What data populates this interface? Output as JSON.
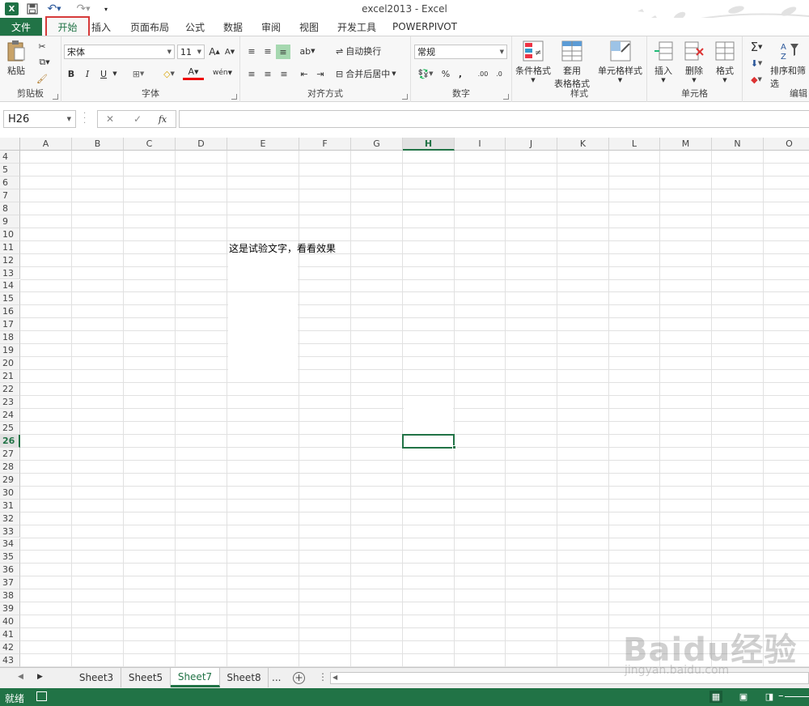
{
  "window": {
    "title": "excel2013 - Excel",
    "logo_letter": "X"
  },
  "ribbon_tabs": {
    "file": "文件",
    "home": "开始",
    "insert": "插入",
    "page_layout": "页面布局",
    "formulas": "公式",
    "data": "数据",
    "review": "审阅",
    "view": "视图",
    "developer": "开发工具",
    "powerpivot": "POWERPIVOT"
  },
  "ribbon": {
    "clipboard": {
      "label": "剪贴板",
      "paste": "粘贴"
    },
    "font": {
      "label": "字体",
      "font_name": "宋体",
      "font_size": "11",
      "bold": "B",
      "italic": "I",
      "underline": "U",
      "wen": "wén"
    },
    "alignment": {
      "label": "对齐方式",
      "wrap_text": "自动换行",
      "merge_center": "合并后居中"
    },
    "number": {
      "label": "数字",
      "format": "常规",
      "percent": "%",
      "comma": ",",
      "inc_dec": ".00",
      "dec_dec": ".0"
    },
    "styles": {
      "label": "样式",
      "conditional": "条件格式",
      "table_format_line1": "套用",
      "table_format_line2": "表格格式",
      "cell_styles": "单元格样式"
    },
    "cells": {
      "label": "单元格",
      "insert": "插入",
      "delete": "删除",
      "format": "格式"
    },
    "editing": {
      "label": "编辑",
      "sort_filter": "排序和筛选",
      "sigma": "Σ"
    }
  },
  "formula_bar": {
    "name_box": "H26",
    "cancel": "✕",
    "enter": "✓",
    "fx": "fx",
    "value": ""
  },
  "sheet": {
    "columns": [
      "A",
      "B",
      "C",
      "D",
      "E",
      "F",
      "G",
      "H",
      "I",
      "J",
      "K",
      "L",
      "M",
      "N",
      "O"
    ],
    "selected_column": "H",
    "rows": [
      "4",
      "5",
      "6",
      "7",
      "8",
      "9",
      "10",
      "11",
      "12",
      "13",
      "14",
      "15",
      "16",
      "17",
      "18",
      "19",
      "20",
      "21",
      "22",
      "23",
      "24",
      "25",
      "26",
      "27",
      "28",
      "29",
      "30",
      "31",
      "32",
      "33",
      "34",
      "35",
      "36",
      "37",
      "38",
      "39",
      "40",
      "41",
      "42",
      "43"
    ],
    "selected_row": "26",
    "active_cell": "H26",
    "cell_text": "这是试验文字，看看效果"
  },
  "sheet_tabs": {
    "tabs": [
      "Sheet3",
      "Sheet5",
      "Sheet7",
      "Sheet8"
    ],
    "active": "Sheet7",
    "more": "...",
    "add": "+"
  },
  "status": {
    "text": "就绪"
  },
  "watermark": {
    "logo": "Baidu经验",
    "url": "jingyan.baidu.com"
  },
  "colors": {
    "accent": "#217346",
    "highlight_box": "#d63a3a"
  }
}
